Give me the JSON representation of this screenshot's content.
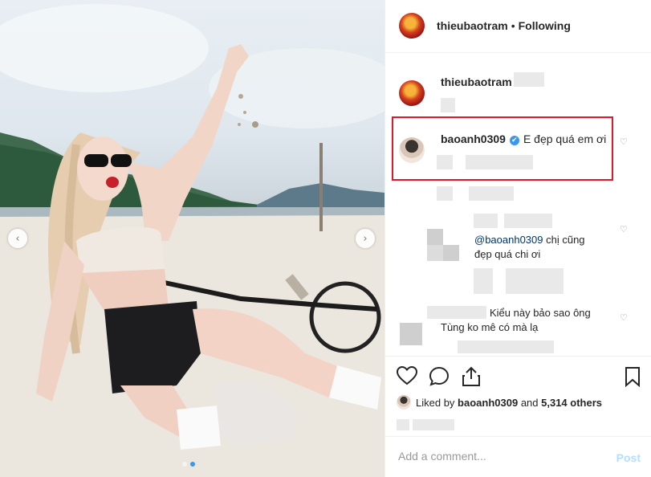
{
  "post": {
    "owner": "thieubaotram",
    "separator": "•",
    "follow_state": "Following",
    "image_count": 2,
    "current_image": 2
  },
  "comments": {
    "caption_user": "thieubaotram",
    "highlighted": {
      "user": "baoanh0309",
      "verified_mark": "✔",
      "text": "E đẹp quá em ơi"
    },
    "reply": {
      "mention": "@baoanh0309",
      "text_line1": " chị cũng",
      "text_line2": "đẹp quá chi ơi"
    },
    "third": {
      "text_line1": "Kiểu này bảo sao ông",
      "text_line2": "Tùng ko mê có mà lạ"
    }
  },
  "likes": {
    "prefix": "Liked by ",
    "user": "baoanh0309",
    "middle": " and ",
    "count": "5,314 others"
  },
  "add_comment": {
    "placeholder": "Add a comment...",
    "post_label": "Post"
  },
  "icons": {
    "prev": "chevron-left-icon",
    "next": "chevron-right-icon",
    "like": "heart-icon",
    "comment": "comment-bubble-icon",
    "share": "share-icon",
    "save": "bookmark-icon"
  },
  "colors": {
    "link": "#003569",
    "verified": "#3897f0",
    "highlight_box": "#e0192a",
    "post_disabled": "#b2dffc"
  }
}
